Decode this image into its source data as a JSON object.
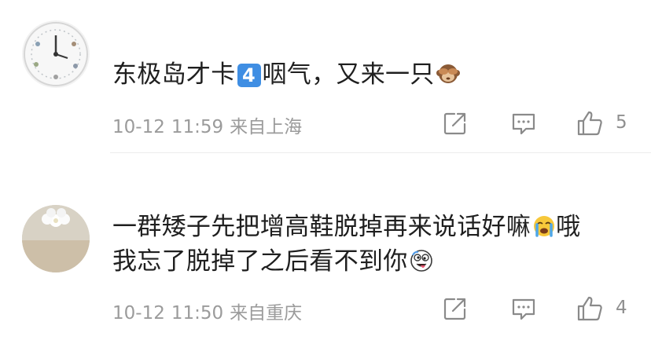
{
  "comments": [
    {
      "avatar_icon": "clock-photo-avatar",
      "text_before_badge": "东极岛才卡",
      "badge": "4",
      "text_after_badge": "咽气，又来一只",
      "emoji": "see-no-evil-monkey-emoji",
      "date": "10-12",
      "time": "11:59",
      "location": "来自上海",
      "likes": "5"
    },
    {
      "avatar_icon": "flower-photo-avatar",
      "line1": "一群矮子先把增高鞋脱掉再来说话好嘛",
      "line1_emoji": "crying-face-emoji",
      "line1_tail": "哦",
      "line2": "我忘了脱掉了之后看不到你",
      "line2_emoji": "silly-face-emoji",
      "date": "10-12",
      "time": "11:50",
      "location": "来自重庆",
      "likes": "4"
    }
  ],
  "icons": {
    "share": "share-icon",
    "reply": "comment-icon",
    "like": "thumbs-up-icon"
  },
  "colors": {
    "text": "#1f1f1f",
    "meta": "#9b9b9b",
    "badge": "#3f8ee3"
  }
}
